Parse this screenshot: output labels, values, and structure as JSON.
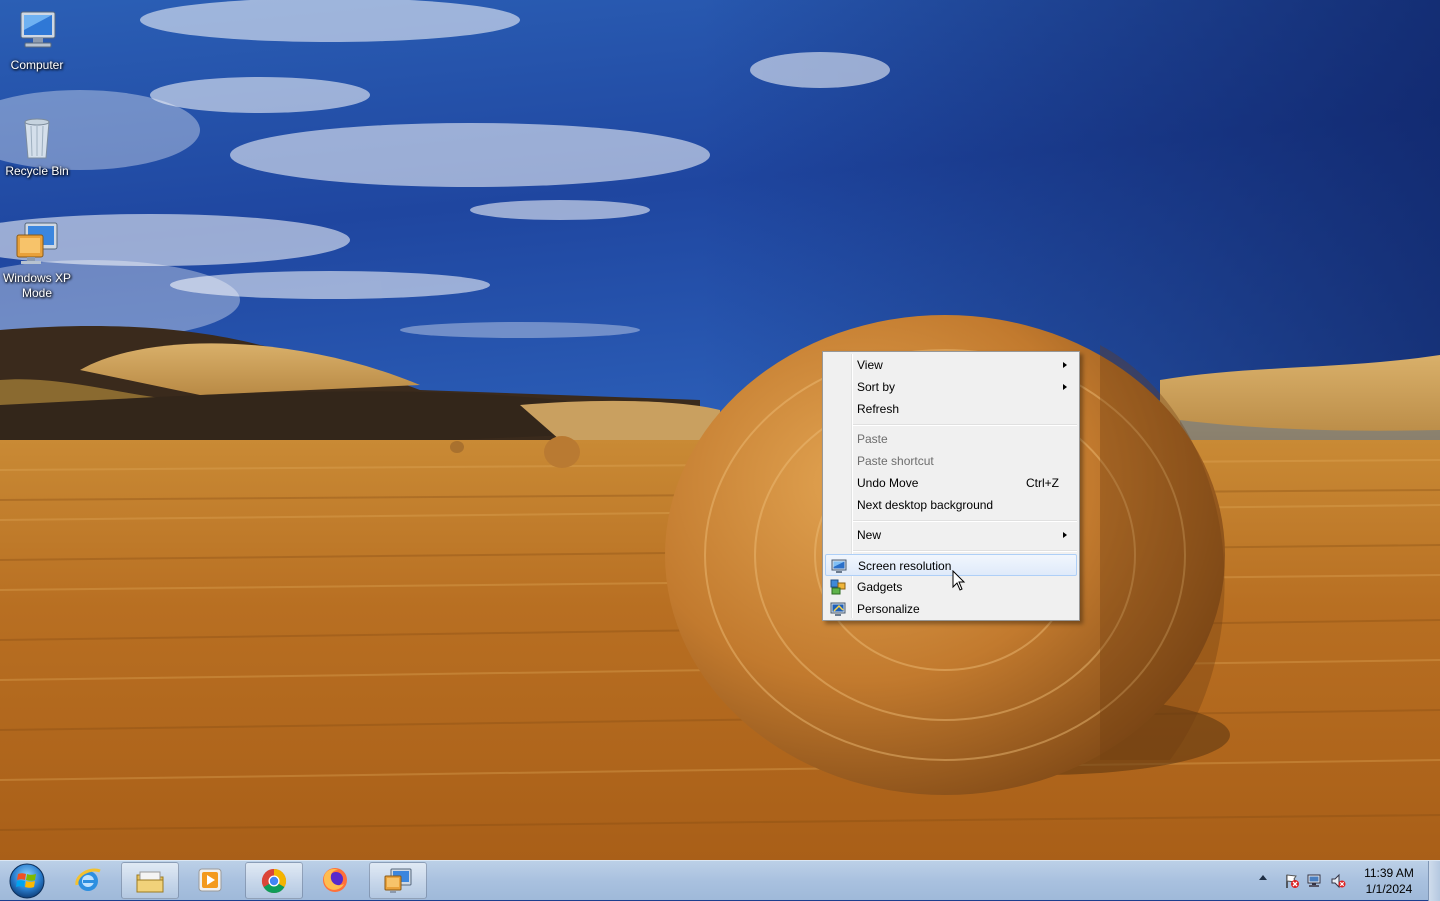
{
  "desktop": {
    "icons": [
      {
        "label": "Computer"
      },
      {
        "label": "Recycle Bin"
      },
      {
        "label": "Windows XP Mode"
      }
    ]
  },
  "context_menu": {
    "items": [
      {
        "label": "View",
        "submenu": true
      },
      {
        "label": "Sort by",
        "submenu": true
      },
      {
        "label": "Refresh"
      },
      {
        "label": "Paste",
        "disabled": true
      },
      {
        "label": "Paste shortcut",
        "disabled": true
      },
      {
        "label": "Undo Move",
        "shortcut": "Ctrl+Z"
      },
      {
        "label": "Next desktop background"
      },
      {
        "label": "New",
        "submenu": true
      },
      {
        "label": "Screen resolution",
        "icon": "monitor-icon",
        "highlighted": true
      },
      {
        "label": "Gadgets",
        "icon": "gadgets-icon"
      },
      {
        "label": "Personalize",
        "icon": "personalize-icon"
      }
    ]
  },
  "taskbar": {
    "pinned": [
      {
        "icon": "internet-explorer-icon"
      },
      {
        "icon": "file-explorer-icon"
      },
      {
        "icon": "media-player-icon"
      },
      {
        "icon": "chrome-icon"
      },
      {
        "icon": "firefox-icon"
      },
      {
        "icon": "windows-xp-mode-icon"
      }
    ],
    "tray_icons": [
      "action-center-flag-icon",
      "network-icon",
      "volume-muted-icon"
    ],
    "clock": {
      "time": "11:39 AM",
      "date": "1/1/2024"
    }
  },
  "colors": {
    "menu_bg": "#f0f0f0",
    "menu_highlight": "#dfeafa",
    "taskbar": "#a9c1df",
    "sky": "#1d3f8f"
  }
}
